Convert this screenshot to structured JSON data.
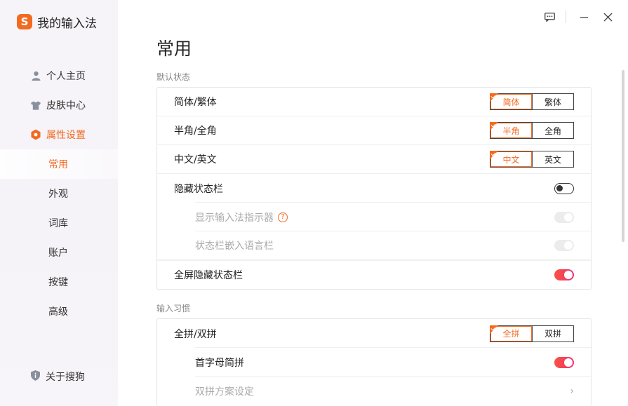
{
  "app": {
    "logo_glyph": "S",
    "title": "我的输入法",
    "accent_color": "#f26a21"
  },
  "window_controls": {
    "feedback_icon": "message-icon",
    "minimize_icon": "minimize-icon",
    "close_icon": "close-icon"
  },
  "sidebar": {
    "items": [
      {
        "label": "个人主页",
        "icon": "user-icon"
      },
      {
        "label": "皮肤中心",
        "icon": "shirt-icon"
      },
      {
        "label": "属性设置",
        "icon": "hexagon-settings-icon",
        "active": true
      }
    ],
    "subitems": [
      {
        "label": "常用",
        "active": true
      },
      {
        "label": "外观"
      },
      {
        "label": "词库"
      },
      {
        "label": "账户"
      },
      {
        "label": "按键"
      },
      {
        "label": "高级"
      }
    ],
    "about": {
      "label": "关于搜狗",
      "icon": "shield-info-icon"
    }
  },
  "main": {
    "title": "常用",
    "section1": {
      "label": "默认状态",
      "rows": {
        "simp_trad": {
          "label": "简体/繁体",
          "options": [
            "简体",
            "繁体"
          ],
          "selected": "简体"
        },
        "half_full": {
          "label": "半角/全角",
          "options": [
            "半角",
            "全角"
          ],
          "selected": "半角"
        },
        "cn_en": {
          "label": "中文/英文",
          "options": [
            "中文",
            "英文"
          ],
          "selected": "中文"
        },
        "hide_status": {
          "label": "隐藏状态栏",
          "state": "off"
        },
        "show_indicator": {
          "label": "显示输入法指示器",
          "state": "disabled",
          "help": "?"
        },
        "embed_lang_bar": {
          "label": "状态栏嵌入语言栏",
          "state": "disabled"
        },
        "fullscreen_hide": {
          "label": "全屏隐藏状态栏",
          "state": "on"
        }
      }
    },
    "section2": {
      "label": "输入习惯",
      "rows": {
        "full_double": {
          "label": "全拼/双拼",
          "options": [
            "全拼",
            "双拼"
          ],
          "selected": "全拼"
        },
        "initial_abbr": {
          "label": "首字母简拼",
          "state": "on"
        },
        "double_scheme": {
          "label": "双拼方案设定",
          "chevron": "›"
        }
      }
    }
  }
}
